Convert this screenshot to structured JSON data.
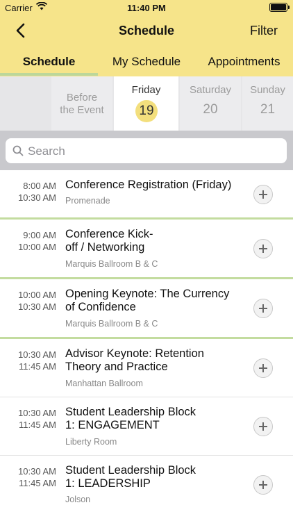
{
  "status_bar": {
    "carrier": "Carrier",
    "time": "11:40 PM"
  },
  "navbar": {
    "title": "Schedule",
    "filter_label": "Filter",
    "back_icon": "chevron-left-icon"
  },
  "tabs": [
    {
      "label": "Schedule",
      "active": true
    },
    {
      "label": "My Schedule",
      "active": false
    },
    {
      "label": "Appointments",
      "active": false
    }
  ],
  "days": [
    {
      "name": "",
      "date": ""
    },
    {
      "name_line1": "Before",
      "name_line2": "the Event"
    },
    {
      "name": "Friday",
      "date": "19",
      "selected": true
    },
    {
      "name": "Saturday",
      "date": "20"
    },
    {
      "name": "Sunday",
      "date": "21"
    }
  ],
  "search": {
    "placeholder": "Search"
  },
  "sessions": [
    {
      "start": "8:00 AM",
      "end": "10:30 AM",
      "title": "Conference Registration (Friday)",
      "location": "Promenade"
    },
    {
      "start": "9:00 AM",
      "end": "10:00 AM",
      "title_line1": "Conference Kick-",
      "title_line2": "off / Networking",
      "location": "Marquis Ballroom B & C"
    },
    {
      "start": "10:00 AM",
      "end": "10:30 AM",
      "title_line1": "Opening Keynote: The Currency",
      "title_line2": "of Confidence",
      "location": "Marquis Ballroom B & C"
    },
    {
      "start": "10:30 AM",
      "end": "11:45 AM",
      "title_line1": "Advisor Keynote: Retention",
      "title_line2": "Theory and Practice",
      "location": "Manhattan Ballroom"
    },
    {
      "start": "10:30 AM",
      "end": "11:45 AM",
      "title_line1": "Student Leadership Block",
      "title_line2": "1: ENGAGEMENT",
      "location": "Liberty Room"
    },
    {
      "start": "10:30 AM",
      "end": "11:45 AM",
      "title_line1": "Student Leadership Block",
      "title_line2": "1: LEADERSHIP",
      "location": "Jolson"
    }
  ],
  "colors": {
    "header_bg": "#f6e48a",
    "accent_green": "#c3dc9f",
    "selected_day": "#f3df7d"
  }
}
